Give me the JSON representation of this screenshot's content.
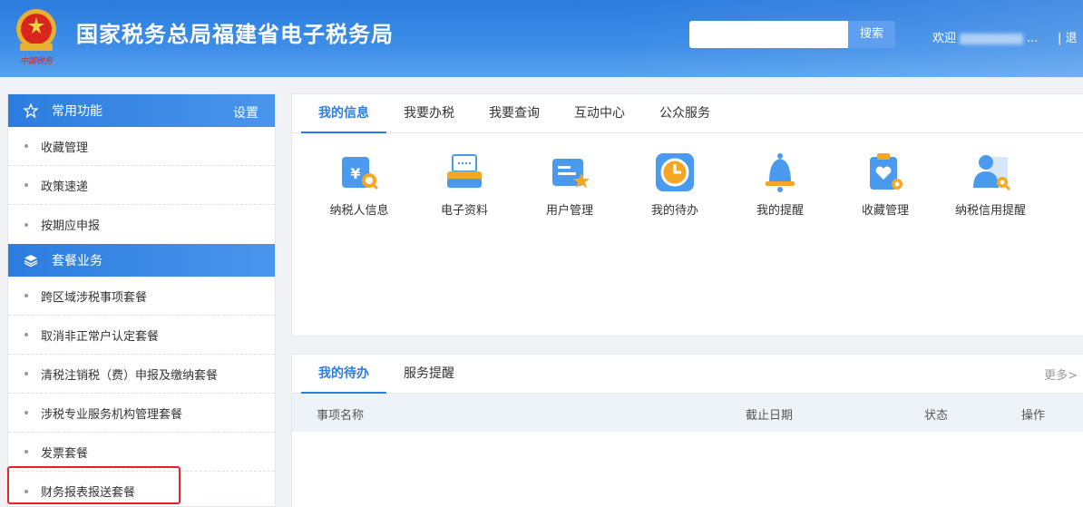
{
  "header": {
    "title": "国家税务总局福建省电子税务局",
    "search_placeholder": "",
    "search_button": "搜索",
    "user_prefix": "欢迎",
    "user_suffix": "...",
    "logout": "| 退"
  },
  "sidebar": {
    "section1": {
      "title": "常用功能",
      "settings": "设置"
    },
    "section1_items": [
      "收藏管理",
      "政策速递",
      "按期应申报"
    ],
    "section2": {
      "title": "套餐业务"
    },
    "section2_items": [
      "跨区域涉税事项套餐",
      "取消非正常户认定套餐",
      "清税注销税（费）申报及缴纳套餐",
      "涉税专业服务机构管理套餐",
      "发票套餐",
      "财务报表报送套餐"
    ]
  },
  "info_panel": {
    "tabs": [
      "我的信息",
      "我要办税",
      "我要查询",
      "互动中心",
      "公众服务"
    ],
    "icons": [
      {
        "label": "纳税人信息",
        "icon": "taxpayer-info-icon"
      },
      {
        "label": "电子资料",
        "icon": "e-document-icon"
      },
      {
        "label": "用户管理",
        "icon": "user-management-icon"
      },
      {
        "label": "我的待办",
        "icon": "todo-clock-icon"
      },
      {
        "label": "我的提醒",
        "icon": "bell-icon"
      },
      {
        "label": "收藏管理",
        "icon": "favorites-icon"
      },
      {
        "label": "纳税信用提醒",
        "icon": "credit-reminder-icon"
      }
    ]
  },
  "todo_panel": {
    "tabs": [
      "我的待办",
      "服务提醒"
    ],
    "more": "更多>",
    "columns": [
      "事项名称",
      "截止日期",
      "状态",
      "操作"
    ]
  },
  "colors": {
    "primary": "#2c7de0",
    "highlight": "#e4222a"
  }
}
